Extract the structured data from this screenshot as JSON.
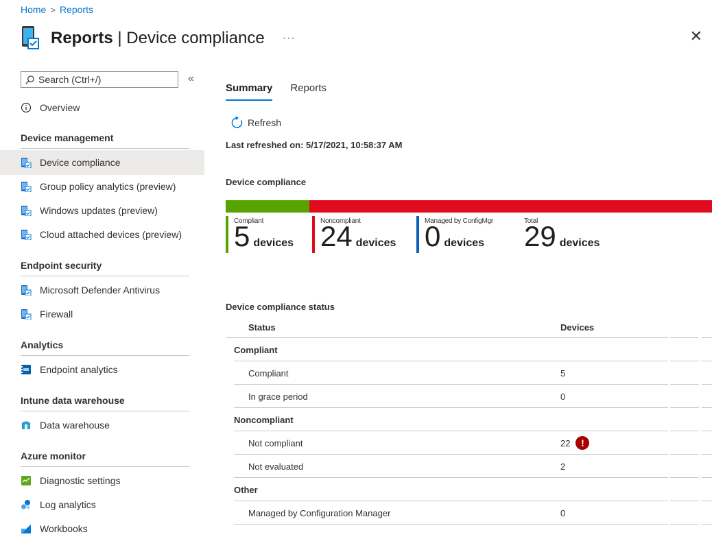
{
  "breadcrumb": {
    "home": "Home",
    "separator": ">",
    "current": "Reports"
  },
  "header": {
    "title_bold": "Reports",
    "title_rest": " | Device compliance",
    "more": "···",
    "close": "✕"
  },
  "search": {
    "placeholder": "Search (Ctrl+/)",
    "collapse": "«"
  },
  "sidebar": {
    "overview": "Overview",
    "device_management": {
      "heading": "Device management",
      "items": [
        "Device compliance",
        "Group policy analytics (preview)",
        "Windows updates (preview)",
        "Cloud attached devices (preview)"
      ]
    },
    "endpoint_security": {
      "heading": "Endpoint security",
      "items": [
        "Microsoft Defender Antivirus",
        "Firewall"
      ]
    },
    "analytics": {
      "heading": "Analytics",
      "items": [
        "Endpoint analytics"
      ]
    },
    "data_warehouse": {
      "heading": "Intune data warehouse",
      "items": [
        "Data warehouse"
      ]
    },
    "azure_monitor": {
      "heading": "Azure monitor",
      "items": [
        "Diagnostic settings",
        "Log analytics",
        "Workbooks"
      ]
    }
  },
  "tabs": [
    "Summary",
    "Reports"
  ],
  "refresh": {
    "label": "Refresh",
    "last_refreshed": "Last refreshed on: 5/17/2021, 10:58:37 AM"
  },
  "compliance": {
    "title": "Device compliance",
    "bar": {
      "compliant": 5,
      "noncompliant": 24,
      "total": 29
    },
    "colors": {
      "compliant": "#57a300",
      "noncompliant": "#e00b1c",
      "configmgr": "#0b5fbd"
    },
    "stats": [
      {
        "label": "Compliant",
        "value": "5",
        "unit": "devices"
      },
      {
        "label": "Noncompliant",
        "value": "24",
        "unit": "devices"
      },
      {
        "label": "Managed by ConfigMgr",
        "value": "0",
        "unit": "devices"
      },
      {
        "label": "Total",
        "value": "29",
        "unit": "devices"
      }
    ]
  },
  "status_table": {
    "title": "Device compliance status",
    "headers": {
      "status": "Status",
      "devices": "Devices"
    },
    "groups": [
      {
        "name": "Compliant",
        "rows": [
          {
            "status": "Compliant",
            "devices": "5"
          },
          {
            "status": "In grace period",
            "devices": "0"
          }
        ]
      },
      {
        "name": "Noncompliant",
        "rows": [
          {
            "status": "Not compliant",
            "devices": "22",
            "alert": "!"
          },
          {
            "status": "Not evaluated",
            "devices": "2"
          }
        ]
      },
      {
        "name": "Other",
        "rows": [
          {
            "status": "Managed by Configuration Manager",
            "devices": "0"
          }
        ]
      }
    ]
  }
}
